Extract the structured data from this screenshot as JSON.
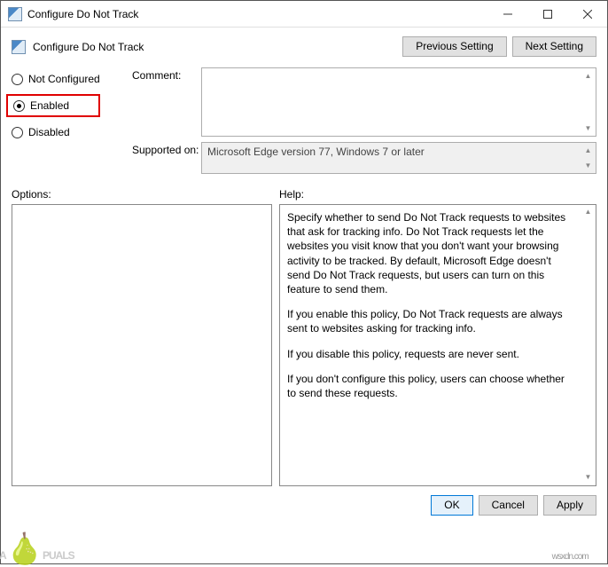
{
  "window": {
    "title": "Configure Do Not Track"
  },
  "header": {
    "title": "Configure Do Not Track",
    "previous_btn": "Previous Setting",
    "next_btn": "Next Setting"
  },
  "radios": {
    "not_configured": "Not Configured",
    "enabled": "Enabled",
    "disabled": "Disabled",
    "selected": "enabled"
  },
  "fields": {
    "comment_label": "Comment:",
    "comment_value": "",
    "supported_label": "Supported on:",
    "supported_value": "Microsoft Edge version 77, Windows 7 or later"
  },
  "labels": {
    "options": "Options:",
    "help": "Help:"
  },
  "help": {
    "p1": "Specify whether to send Do Not Track requests to websites that ask for tracking info. Do Not Track requests let the websites you visit know that you don't want your browsing activity to be tracked. By default, Microsoft Edge doesn't send Do Not Track requests, but users can turn on this feature to send them.",
    "p2": "If you enable this policy, Do Not Track requests are always sent to websites asking for tracking info.",
    "p3": "If you disable this policy, requests are never sent.",
    "p4": "If you don't configure this policy, users can choose whether to send these requests."
  },
  "footer": {
    "ok": "OK",
    "cancel": "Cancel",
    "apply": "Apply"
  },
  "watermark": {
    "text_before": "A",
    "text_after": "PUALS",
    "site": "wsxdn.com"
  }
}
